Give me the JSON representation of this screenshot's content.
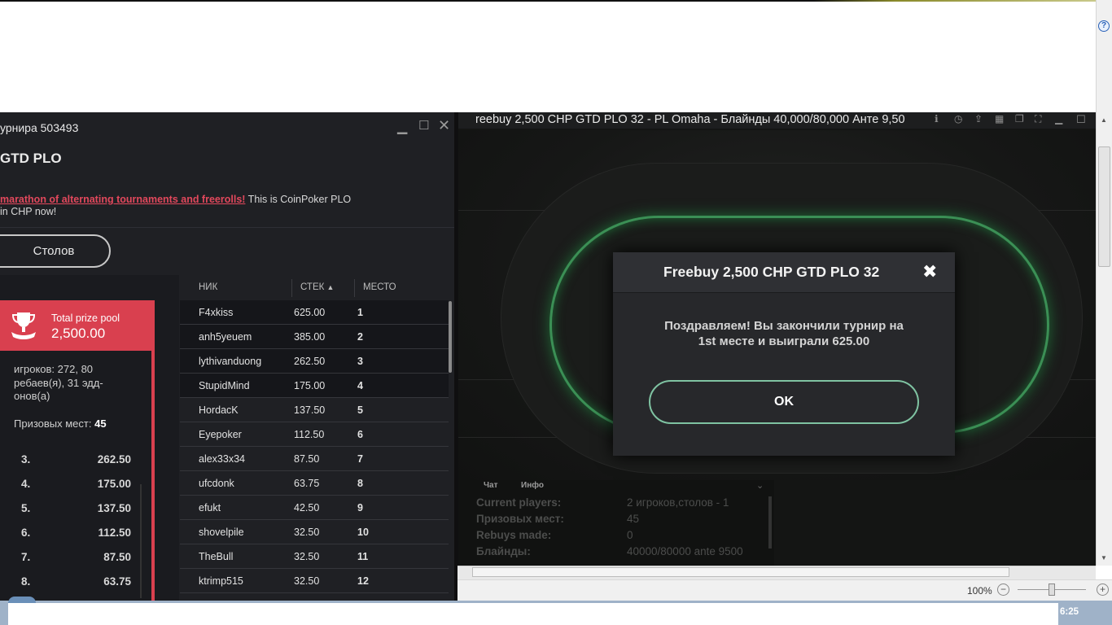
{
  "lobby": {
    "window_title": "урнира 503493",
    "tournament_name": "GTD PLO",
    "description_link": "marathon of alternating tournaments and freerolls!",
    "description_text": " This is CoinPoker PLO",
    "description_text2": "in CHP now!",
    "tables_button": "Столов",
    "prize_label": "Total prize pool",
    "prize_value": "2,500.00",
    "players_info": "игроков: 272, 80 ребаев(я), 31 эдд-онов(а)",
    "places_label": "Призовых мест:",
    "places_value": "45",
    "payouts": [
      {
        "place": "3.",
        "amount": "262.50"
      },
      {
        "place": "4.",
        "amount": "175.00"
      },
      {
        "place": "5.",
        "amount": "137.50"
      },
      {
        "place": "6.",
        "amount": "112.50"
      },
      {
        "place": "7.",
        "amount": "87.50"
      },
      {
        "place": "8.",
        "amount": "63.75"
      }
    ],
    "columns": {
      "nick": "НИК",
      "stack": "СТЕК",
      "place": "МЕСТО"
    },
    "players": [
      {
        "nick": "F4xkiss",
        "stack": "625.00",
        "place": "1"
      },
      {
        "nick": "anh5yeuem",
        "stack": "385.00",
        "place": "2"
      },
      {
        "nick": "lythivanduong",
        "stack": "262.50",
        "place": "3"
      },
      {
        "nick": "StupidMind",
        "stack": "175.00",
        "place": "4"
      },
      {
        "nick": "HordacK",
        "stack": "137.50",
        "place": "5"
      },
      {
        "nick": "Eyepoker",
        "stack": "112.50",
        "place": "6"
      },
      {
        "nick": "alex33x34",
        "stack": "87.50",
        "place": "7"
      },
      {
        "nick": "ufcdonk",
        "stack": "63.75",
        "place": "8"
      },
      {
        "nick": "efukt",
        "stack": "42.50",
        "place": "9"
      },
      {
        "nick": "shovelpile",
        "stack": "32.50",
        "place": "10"
      },
      {
        "nick": "TheBull",
        "stack": "32.50",
        "place": "11"
      },
      {
        "nick": "ktrimp515",
        "stack": "32.50",
        "place": "12"
      }
    ]
  },
  "table": {
    "title": "reebuy 2,500 CHP GTD PLO 32 - PL Omaha - Блайнды 40,000/80,000 Анте 9,50",
    "tabs": [
      "Чат",
      "Инфо"
    ],
    "info_rows": [
      {
        "label": "Current players:",
        "value": "2 игроков,столов - 1"
      },
      {
        "label": "Призовых мест:",
        "value": "45"
      },
      {
        "label": "Rebuys made:",
        "value": "0"
      },
      {
        "label": "Блайнды:",
        "value": "40000/80000 ante 9500"
      }
    ]
  },
  "dialog": {
    "title": "Freebuy 2,500 CHP GTD PLO 32",
    "message_line1": "Поздравляем! Вы закончили турнир на",
    "message_line2": "1st месте и выиграли 625.00",
    "ok_label": "OK"
  },
  "statusbar": {
    "zoom": "100%"
  },
  "taskbar": {
    "clock": "6:25"
  },
  "colors": {
    "accent_red": "#d9404f",
    "felt_green": "#3b8f55",
    "ok_border": "#7fc3a2"
  }
}
